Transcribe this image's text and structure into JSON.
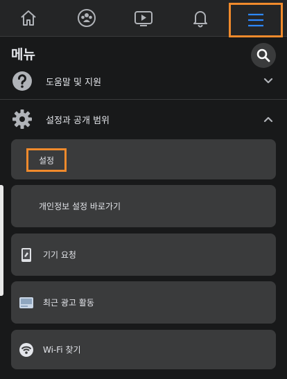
{
  "nav": {
    "tabs": [
      {
        "icon": "home-icon"
      },
      {
        "icon": "groups-icon"
      },
      {
        "icon": "watch-icon"
      },
      {
        "icon": "bell-icon"
      },
      {
        "icon": "menu-icon",
        "active": true
      }
    ],
    "accent": "#2d88ff",
    "highlight": "#f08a2c"
  },
  "menu": {
    "title": "메뉴",
    "search_icon": "search-icon"
  },
  "sections": {
    "help": {
      "label": "도움말 및 지원",
      "icon": "question-icon"
    },
    "settings_privacy": {
      "label": "설정과 공개 범위",
      "icon": "gear-icon",
      "expanded": true
    }
  },
  "items": {
    "settings": {
      "label": "설정"
    },
    "privacy_shortcut": {
      "label": "개인정보 설정 바로가기"
    },
    "device_requests": {
      "label": "기기 요청",
      "icon": "phone-icon"
    },
    "recent_ad_activity": {
      "label": "최근 광고 활동",
      "icon": "ad-activity-icon"
    },
    "find_wifi": {
      "label": "Wi-Fi 찾기",
      "icon": "wifi-icon"
    }
  }
}
